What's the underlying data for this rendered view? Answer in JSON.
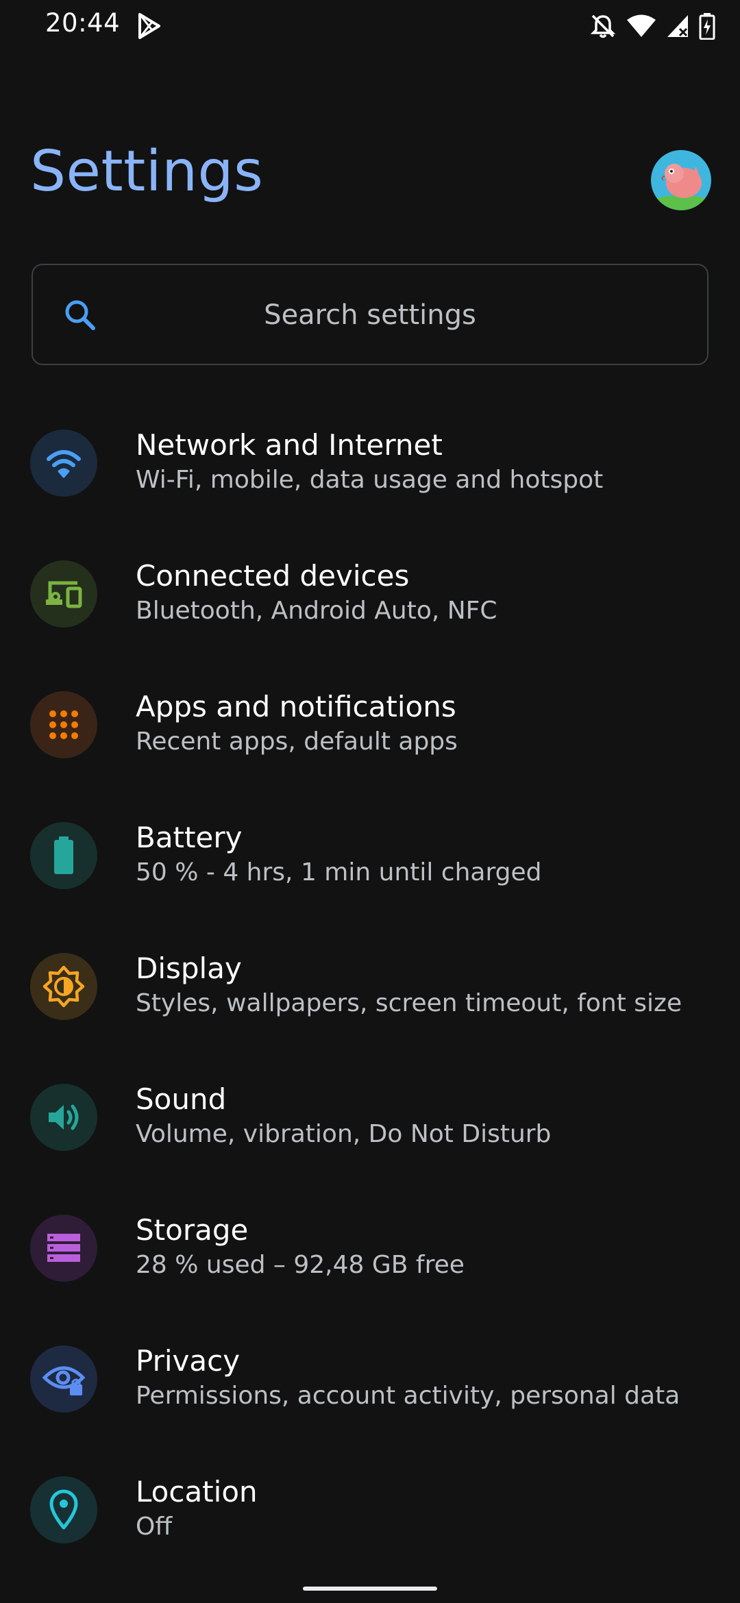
{
  "status_bar": {
    "time": "20:44",
    "left_icons": [
      "play-store-icon"
    ],
    "right_icons": [
      "notifications-off-icon",
      "wifi-icon",
      "cellular-signal-icon",
      "battery-charging-icon"
    ]
  },
  "header": {
    "title": "Settings",
    "avatar": "profile-avatar"
  },
  "search": {
    "placeholder": "Search settings",
    "icon": "search-icon"
  },
  "colors": {
    "background": "#121212",
    "title": "#8ab4f8",
    "primary_text": "#ffffff",
    "secondary_text": "#bdc1c6"
  },
  "items": [
    {
      "title": "Network and Internet",
      "summary": "Wi-Fi, mobile, data usage and hotspot",
      "icon": "wifi-icon",
      "color": "#4a9ff5",
      "bg": "#1b2a3d"
    },
    {
      "title": "Connected devices",
      "summary": "Bluetooth, Android Auto, NFC",
      "icon": "devices-icon",
      "color": "#7cb342",
      "bg": "#24301c"
    },
    {
      "title": "Apps and notifications",
      "summary": "Recent apps, default apps",
      "icon": "apps-grid-icon",
      "color": "#f57c00",
      "bg": "#3a2418"
    },
    {
      "title": "Battery",
      "summary": "50 % - 4 hrs, 1 min until charged",
      "icon": "battery-icon",
      "color": "#26a69a",
      "bg": "#17302d"
    },
    {
      "title": "Display",
      "summary": "Styles, wallpapers, screen timeout, font size",
      "icon": "brightness-icon",
      "color": "#f6a623",
      "bg": "#3a2e18"
    },
    {
      "title": "Sound",
      "summary": "Volume, vibration, Do Not Disturb",
      "icon": "volume-icon",
      "color": "#26a69a",
      "bg": "#17302d"
    },
    {
      "title": "Storage",
      "summary": "28 % used – 92,48 GB free",
      "icon": "storage-icon",
      "color": "#ba5fdc",
      "bg": "#2f1d37"
    },
    {
      "title": "Privacy",
      "summary": "Permissions, account activity, personal data",
      "icon": "privacy-eye-icon",
      "color": "#5c8ef2",
      "bg": "#1e2a42"
    },
    {
      "title": "Location",
      "summary": "Off",
      "icon": "location-pin-icon",
      "color": "#26c6da",
      "bg": "#173033"
    }
  ]
}
